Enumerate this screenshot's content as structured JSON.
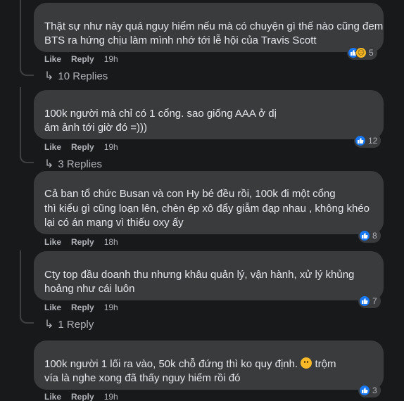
{
  "colors": {
    "bubble": "#3a3b3c",
    "background": "#18191a",
    "like_blue": "#1877f2",
    "text": "#e4e6eb",
    "muted": "#b0b3b8"
  },
  "comments": [
    {
      "lines": [
        "Thật sự như này quá nguy hiểm nếu mà có chuyện gì thế nào cũng đem",
        "BTS ra hứng chịu làm mình nhớ tới lễ hội của Travis Scott"
      ],
      "reactions": {
        "icons": [
          "like-icon",
          "sad-icon"
        ],
        "count": "5"
      },
      "like": "Like",
      "reply": "Reply",
      "time": "19h",
      "replies": "10 Replies"
    },
    {
      "lines": [
        "100k người mà chỉ có 1 cổng.        sao giống AAA ở                dị",
        "ám ảnh tới giờ đó        =)))"
      ],
      "reactions": {
        "icons": [
          "like-icon"
        ],
        "count": "12"
      },
      "like": "Like",
      "reply": "Reply",
      "time": "19h",
      "replies": "3 Replies"
    },
    {
      "lines": [
        "Cả ban tổ chức Busan và con Hy bé đều                rồi, 100k đi một cổng",
        "thì kiểu gì cũng loạn lên, chèn ép xô đẩy giẫm đạp nhau , không khéo",
        "lại có án mạng vì thiếu oxy ấy"
      ],
      "reactions": {
        "icons": [
          "like-icon"
        ],
        "count": "8"
      },
      "like": "Like",
      "reply": "Reply",
      "time": "18h",
      "replies": ""
    },
    {
      "lines": [
        "Cty top đầu doanh thu nhưng khâu quản lý, vận hành, xử lý khủng",
        "hoảng như cái        luôn"
      ],
      "reactions": {
        "icons": [
          "like-icon"
        ],
        "count": "7"
      },
      "like": "Like",
      "reply": "Reply",
      "time": "19h",
      "replies": "1 Reply"
    },
    {
      "line1_a": "        100k người 1 lối ra vào, 50k chỗ đứng thì ko quy định.",
      "line1_b": "trộm",
      "line2": "vía là          nghe xong đã thấy nguy hiểm rồi đó",
      "reactions": {
        "icons": [
          "like-icon"
        ],
        "count": "3"
      },
      "like": "Like",
      "reply": "Reply",
      "time": "19h"
    }
  ]
}
